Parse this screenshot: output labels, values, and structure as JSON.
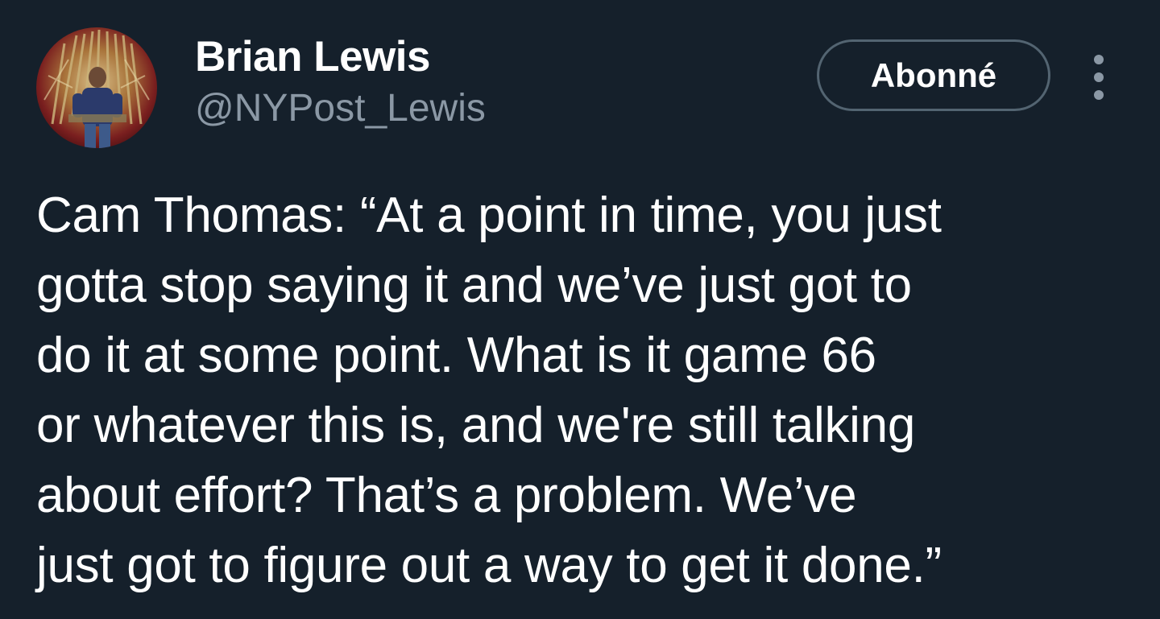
{
  "author": {
    "display_name": "Brian Lewis",
    "handle": "@NYPost_Lewis",
    "avatar_icon": "profile-photo-throne"
  },
  "actions": {
    "follow_label": "Abonné",
    "more_icon": "more-vertical-icon"
  },
  "tweet": {
    "lines": [
      "Cam Thomas: “At a point in time, you just",
      "gotta stop saying it and we’ve just got to",
      "do it at some point. What is it game 66",
      "or whatever this is, and we're still talking",
      "about effort? That’s a problem. We’ve",
      "just got to figure out a way to get it done.”"
    ]
  },
  "colors": {
    "background": "#15202b",
    "primary_text": "#ffffff",
    "secondary_text": "#8b98a5",
    "button_border": "#536471"
  }
}
